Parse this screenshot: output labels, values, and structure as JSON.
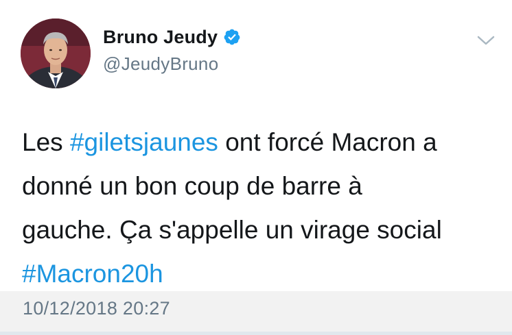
{
  "author": {
    "display_name": "Bruno Jeudy",
    "handle": "@JeudyBruno",
    "verified": true,
    "avatar_icon": "profile-photo"
  },
  "tweet": {
    "segments": [
      {
        "type": "text",
        "value": "Les "
      },
      {
        "type": "hashtag",
        "value": "#giletsjaunes"
      },
      {
        "type": "text",
        "value": " ont forcé Macron a"
      },
      {
        "type": "break"
      },
      {
        "type": "text",
        "value": "donné un bon coup de barre à"
      },
      {
        "type": "break"
      },
      {
        "type": "text",
        "value": "gauche. Ça s'appelle un virage social"
      },
      {
        "type": "break"
      },
      {
        "type": "hashtag",
        "value": "#Macron20h"
      }
    ],
    "timestamp": "10/12/2018 20:27"
  },
  "icons": {
    "verified": "verified-badge-icon",
    "menu": "chevron-down-icon"
  },
  "colors": {
    "hashtag": "#1b95e0",
    "verified": "#1da1f2",
    "text": "#14171a",
    "secondary": "#657786"
  }
}
